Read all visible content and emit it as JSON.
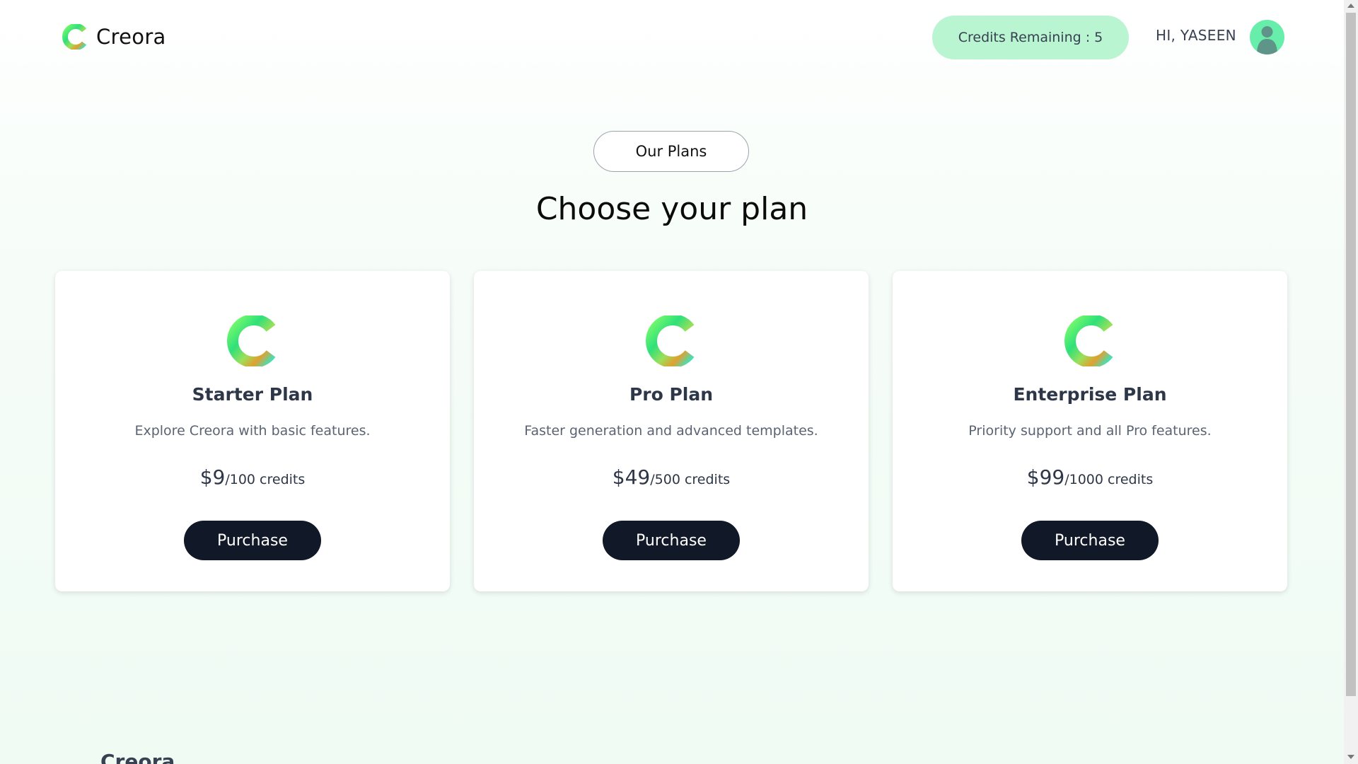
{
  "header": {
    "brand": "Creora",
    "credits_label": "Credits Remaining : 5",
    "greeting": "HI, YASEEN"
  },
  "main": {
    "badge": "Our Plans",
    "title": "Choose your plan",
    "plans": [
      {
        "name": "Starter Plan",
        "description": "Explore Creora with basic features.",
        "price": "$9",
        "credits": "/100 credits",
        "button": "Purchase"
      },
      {
        "name": "Pro Plan",
        "description": "Faster generation and advanced templates.",
        "price": "$49",
        "credits": "/500 credits",
        "button": "Purchase"
      },
      {
        "name": "Enterprise Plan",
        "description": "Priority support and all Pro features.",
        "price": "$99",
        "credits": "/1000 credits",
        "button": "Purchase"
      }
    ]
  },
  "footer": {
    "brand": "Creora"
  },
  "colors": {
    "accent": "#b9f5d0",
    "button": "#111827",
    "avatar": "#67eeaa"
  }
}
